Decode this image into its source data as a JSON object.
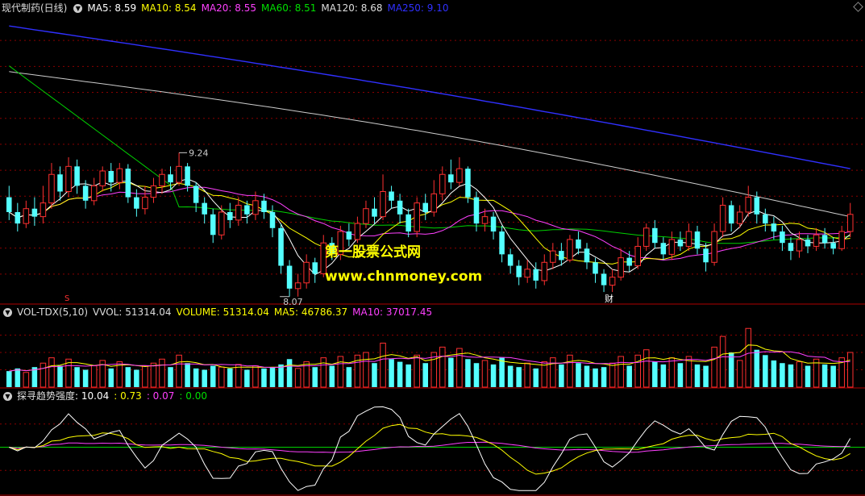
{
  "main_panel": {
    "stock_name": "现代制药(日线)",
    "indicators": [
      {
        "label": "MA5: 8.59",
        "color": "#ffffff"
      },
      {
        "label": "MA10: 8.54",
        "color": "#ffff00"
      },
      {
        "label": "MA20: 8.55",
        "color": "#ff40ff"
      },
      {
        "label": "MA60: 8.51",
        "color": "#00e000"
      },
      {
        "label": "MA120: 8.68",
        "color": "#dddddd"
      },
      {
        "label": "MA250: 9.10",
        "color": "#3030ff"
      }
    ],
    "high_label": "9.24",
    "low_label": "8.07",
    "marker_s": "S",
    "marker_cai": "财"
  },
  "volume_panel": {
    "name": "VOL-TDX(5,10)",
    "indicators": [
      {
        "label": "VVOL: 51314.04",
        "color": "#dddddd"
      },
      {
        "label": "VOLUME: 51314.04",
        "color": "#ffff00"
      },
      {
        "label": "MA5: 46786.37",
        "color": "#ffff00"
      },
      {
        "label": "MA10: 37017.45",
        "color": "#ff40ff"
      }
    ]
  },
  "strength_panel": {
    "name": "探寻趋势强度",
    "indicators": [
      {
        "label": ": 10.04",
        "color": "#ffffff"
      },
      {
        "label": ": 0.73",
        "color": "#ffff00"
      },
      {
        "label": ": 0.07",
        "color": "#ff40ff"
      },
      {
        "label": ": 0.00",
        "color": "#00e000"
      }
    ]
  },
  "watermark": {
    "line1": "第一股票公式网",
    "line2": "www.chnmoney.com"
  },
  "chart_data": {
    "type": "candlestick",
    "up_color": "#ff3030",
    "down_color": "#54ffff",
    "price_range": [
      7.95,
      10.45
    ],
    "candles": [
      [
        8.85,
        8.72,
        8.95,
        8.65
      ],
      [
        8.72,
        8.62,
        8.8,
        8.55
      ],
      [
        8.62,
        8.75,
        8.82,
        8.58
      ],
      [
        8.75,
        8.68,
        8.85,
        8.6
      ],
      [
        8.68,
        8.8,
        8.95,
        8.62
      ],
      [
        8.8,
        9.05,
        9.15,
        8.75
      ],
      [
        9.05,
        8.9,
        9.12,
        8.82
      ],
      [
        8.9,
        9.12,
        9.2,
        8.85
      ],
      [
        9.12,
        8.95,
        9.18,
        8.88
      ],
      [
        8.95,
        8.82,
        9.0,
        8.75
      ],
      [
        8.82,
        8.95,
        9.02,
        8.78
      ],
      [
        8.95,
        9.08,
        9.12,
        8.9
      ],
      [
        9.08,
        8.98,
        9.15,
        8.9
      ],
      [
        8.98,
        9.1,
        9.15,
        8.92
      ],
      [
        9.1,
        8.85,
        9.14,
        8.8
      ],
      [
        8.85,
        8.75,
        8.92,
        8.68
      ],
      [
        8.75,
        8.85,
        8.95,
        8.7
      ],
      [
        8.85,
        8.95,
        9.02,
        8.8
      ],
      [
        8.95,
        9.05,
        9.1,
        8.88
      ],
      [
        9.05,
        8.98,
        9.12,
        8.92
      ],
      [
        8.98,
        9.12,
        9.24,
        8.95
      ],
      [
        9.12,
        8.95,
        9.15,
        8.9
      ],
      [
        8.95,
        8.8,
        8.98,
        8.72
      ],
      [
        8.8,
        8.7,
        8.85,
        8.62
      ],
      [
        8.7,
        8.52,
        8.75,
        8.45
      ],
      [
        8.52,
        8.72,
        8.78,
        8.48
      ],
      [
        8.72,
        8.65,
        8.8,
        8.58
      ],
      [
        8.65,
        8.78,
        8.85,
        8.6
      ],
      [
        8.78,
        8.7,
        8.82,
        8.62
      ],
      [
        8.7,
        8.82,
        8.9,
        8.65
      ],
      [
        8.82,
        8.72,
        8.88,
        8.66
      ],
      [
        8.72,
        8.58,
        8.78,
        8.5
      ],
      [
        8.58,
        8.25,
        8.62,
        8.18
      ],
      [
        8.25,
        8.05,
        8.3,
        7.98
      ],
      [
        8.05,
        8.1,
        8.18,
        7.98
      ],
      [
        8.1,
        8.28,
        8.35,
        8.05
      ],
      [
        8.28,
        8.18,
        8.32,
        8.1
      ],
      [
        8.18,
        8.45,
        8.52,
        8.15
      ],
      [
        8.45,
        8.35,
        8.5,
        8.3
      ],
      [
        8.35,
        8.55,
        8.6,
        8.3
      ],
      [
        8.55,
        8.48,
        8.62,
        8.42
      ],
      [
        8.48,
        8.62,
        8.68,
        8.45
      ],
      [
        8.62,
        8.75,
        8.82,
        8.58
      ],
      [
        8.75,
        8.68,
        8.85,
        8.62
      ],
      [
        8.68,
        8.9,
        9.05,
        8.65
      ],
      [
        8.9,
        8.82,
        8.95,
        8.75
      ],
      [
        8.82,
        8.7,
        8.88,
        8.62
      ],
      [
        8.7,
        8.55,
        8.75,
        8.5
      ],
      [
        8.55,
        8.8,
        8.85,
        8.5
      ],
      [
        8.8,
        8.72,
        8.88,
        8.65
      ],
      [
        8.72,
        8.88,
        9.0,
        8.68
      ],
      [
        8.88,
        9.05,
        9.12,
        8.82
      ],
      [
        9.05,
        8.98,
        9.18,
        8.92
      ],
      [
        8.98,
        9.1,
        9.2,
        8.95
      ],
      [
        9.1,
        8.85,
        9.12,
        8.8
      ],
      [
        8.85,
        8.62,
        8.9,
        8.55
      ],
      [
        8.62,
        8.68,
        8.75,
        8.55
      ],
      [
        8.68,
        8.55,
        8.72,
        8.48
      ],
      [
        8.55,
        8.35,
        8.6,
        8.28
      ],
      [
        8.35,
        8.25,
        8.4,
        8.18
      ],
      [
        8.25,
        8.15,
        8.3,
        8.08
      ],
      [
        8.15,
        8.22,
        8.3,
        8.1
      ],
      [
        8.22,
        8.12,
        8.28,
        8.05
      ],
      [
        8.12,
        8.28,
        8.35,
        8.08
      ],
      [
        8.28,
        8.38,
        8.45,
        8.22
      ],
      [
        8.38,
        8.3,
        8.45,
        8.25
      ],
      [
        8.3,
        8.48,
        8.52,
        8.28
      ],
      [
        8.48,
        8.4,
        8.55,
        8.35
      ],
      [
        8.4,
        8.28,
        8.45,
        8.22
      ],
      [
        8.28,
        8.18,
        8.32,
        8.1
      ],
      [
        8.18,
        8.08,
        8.22,
        8.02
      ],
      [
        8.08,
        8.15,
        8.22,
        8.02
      ],
      [
        8.15,
        8.32,
        8.4,
        8.12
      ],
      [
        8.32,
        8.25,
        8.38,
        8.2
      ],
      [
        8.25,
        8.42,
        8.5,
        8.22
      ],
      [
        8.42,
        8.58,
        8.62,
        8.38
      ],
      [
        8.58,
        8.45,
        8.65,
        8.4
      ],
      [
        8.45,
        8.35,
        8.5,
        8.3
      ],
      [
        8.35,
        8.48,
        8.55,
        8.3
      ],
      [
        8.48,
        8.42,
        8.55,
        8.38
      ],
      [
        8.42,
        8.55,
        8.62,
        8.38
      ],
      [
        8.55,
        8.4,
        8.6,
        8.35
      ],
      [
        8.4,
        8.28,
        8.45,
        8.2
      ],
      [
        8.28,
        8.55,
        8.62,
        8.25
      ],
      [
        8.55,
        8.78,
        8.85,
        8.5
      ],
      [
        8.78,
        8.62,
        8.82,
        8.55
      ],
      [
        8.62,
        8.72,
        8.78,
        8.58
      ],
      [
        8.72,
        8.85,
        8.95,
        8.68
      ],
      [
        8.85,
        8.7,
        8.9,
        8.62
      ],
      [
        8.7,
        8.62,
        8.75,
        8.55
      ],
      [
        8.62,
        8.55,
        8.68,
        8.48
      ],
      [
        8.55,
        8.45,
        8.6,
        8.38
      ],
      [
        8.45,
        8.38,
        8.5,
        8.3
      ],
      [
        8.38,
        8.48,
        8.55,
        8.32
      ],
      [
        8.48,
        8.42,
        8.52,
        8.36
      ],
      [
        8.42,
        8.52,
        8.58,
        8.38
      ],
      [
        8.52,
        8.45,
        8.58,
        8.4
      ],
      [
        8.45,
        8.4,
        8.5,
        8.35
      ],
      [
        8.4,
        8.55,
        8.6,
        8.38
      ],
      [
        8.55,
        8.7,
        8.8,
        8.5
      ]
    ],
    "volume_range": [
      0,
      52000
    ],
    "volumes": [
      12000,
      14000,
      11000,
      15000,
      18000,
      22000,
      16000,
      21000,
      15000,
      13000,
      16000,
      20000,
      14000,
      19000,
      15000,
      13000,
      16000,
      18000,
      21000,
      15000,
      24000,
      18000,
      14000,
      13000,
      16000,
      15000,
      14000,
      17000,
      13000,
      16000,
      14000,
      15000,
      17000,
      21000,
      14000,
      19000,
      15000,
      22000,
      16000,
      23000,
      15000,
      24000,
      26000,
      18000,
      33000,
      21000,
      19000,
      17000,
      24000,
      18000,
      26000,
      30000,
      22000,
      29000,
      21000,
      18000,
      20000,
      17000,
      22000,
      16000,
      15000,
      18000,
      14000,
      19000,
      22000,
      17000,
      24000,
      18000,
      16000,
      14000,
      15000,
      18000,
      23000,
      16000,
      24000,
      28000,
      19000,
      17000,
      22000,
      18000,
      23000,
      17000,
      16000,
      30000,
      38000,
      26000,
      20000,
      44000,
      28000,
      24000,
      20000,
      18000,
      17000,
      19000,
      16000,
      21000,
      17000,
      16000,
      22000,
      26000
    ],
    "strength_range": [
      -30,
      30
    ]
  }
}
